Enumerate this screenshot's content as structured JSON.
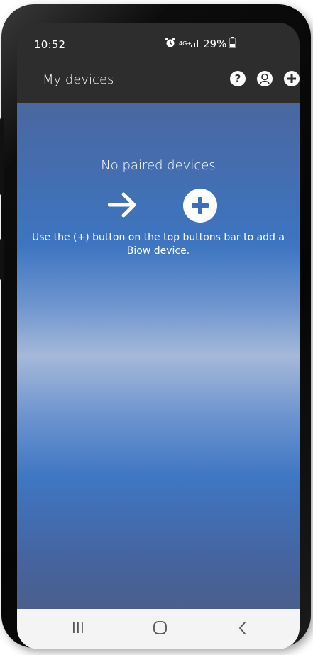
{
  "status": {
    "time": "10:52",
    "network": "4G+",
    "battery": "29%"
  },
  "appbar": {
    "title": "My devices",
    "actions": [
      {
        "name": "help-button",
        "icon": "question-icon"
      },
      {
        "name": "account-button",
        "icon": "user-icon"
      },
      {
        "name": "add-device-button",
        "icon": "plus-icon"
      }
    ]
  },
  "empty_state": {
    "title": "No paired devices",
    "hint": "Use the (+) button on the top buttons bar to add a Biow device.",
    "arrow_icon": "arrow-right-icon",
    "plus_icon": "plus-circle-icon"
  },
  "navbar": {
    "items": [
      "recents-button",
      "home-button",
      "back-button"
    ]
  },
  "colors": {
    "bar": "#2d2d2d",
    "content_top": "#4a67a0",
    "content_mid": "#a5b9d9",
    "navbar": "#f4f4f4"
  }
}
